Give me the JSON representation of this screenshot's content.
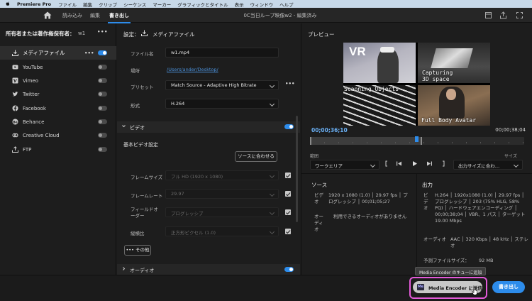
{
  "menubar": {
    "app_name": "Premiere Pro",
    "items": [
      "ファイル",
      "編集",
      "クリップ",
      "シーケンス",
      "マーカー",
      "グラフィックとタイトル",
      "表示",
      "ウィンドウ",
      "ヘルプ"
    ]
  },
  "titlebar": {
    "tabs": [
      "読み込み",
      "編集",
      "書き出し"
    ],
    "active_tab": "書き出し",
    "document_title": "0C当日ループ映像w2 - 編集済み"
  },
  "left_panel": {
    "owner_label": "所有者または著作権保有者：",
    "owner_value": "w1",
    "destinations": [
      {
        "label": "メディアファイル",
        "enabled": true,
        "selected": true,
        "icon": "media-file-icon"
      },
      {
        "label": "YouTube",
        "enabled": false,
        "icon": "youtube-icon"
      },
      {
        "label": "Vimeo",
        "enabled": false,
        "icon": "vimeo-icon"
      },
      {
        "label": "Twitter",
        "enabled": false,
        "icon": "twitter-icon"
      },
      {
        "label": "Facebook",
        "enabled": false,
        "icon": "facebook-icon"
      },
      {
        "label": "Behance",
        "enabled": false,
        "icon": "behance-icon"
      },
      {
        "label": "Creative Cloud",
        "enabled": false,
        "icon": "creative-cloud-icon"
      },
      {
        "label": "FTP",
        "enabled": false,
        "icon": "ftp-icon"
      }
    ]
  },
  "settings": {
    "header_label": "設定：",
    "header_value": "メディアファイル",
    "filename_label": "ファイル名",
    "filename_value": "w1.mp4",
    "location_label": "場所",
    "location_value": "/Users/ander/Desktop/",
    "preset_label": "プリセット",
    "preset_value": "Match Source - Adaptive High Bitrate",
    "format_label": "形式",
    "format_value": "H.264",
    "video_section": "ビデオ",
    "basic_video": "基本ビデオ設定",
    "match_source_button": "ソースに合わせる",
    "frame_size_label": "フレームサイズ",
    "frame_size_value": "フル HD (1920 x 1080)",
    "frame_rate_label": "フレームレート",
    "frame_rate_value": "29.97",
    "field_order_label": "フィールドオーダー",
    "field_order_value": "プログレッシブ",
    "aspect_label": "縦横比",
    "aspect_value": "正方形ピクセル (1.0)",
    "more_button": "その他",
    "audio_section": "オーディオ"
  },
  "preview": {
    "title": "プレビュー",
    "quadrant_texts": {
      "q1": "VR",
      "q2": "Capturing\n3D space",
      "q3": "Scanning Objects",
      "q4": "Full Body Avatar"
    },
    "timecode_current": "00;00;36;10",
    "timecode_end": "00;00;38;04",
    "range_label": "範囲",
    "range_value": "ワークエリア",
    "size_label": "サイズ",
    "size_value": "出力サイズに合わ…"
  },
  "source_info": {
    "title": "ソース",
    "video_key": "ビデオ",
    "video_value": "1920 x 1080 (1.0) │ 29.97 fps │ プログレッシブ │ 00;01;05;27",
    "audio_key": "オーディオ",
    "audio_value": "利用できるオーディオがありません"
  },
  "output_info": {
    "title": "出力",
    "video_key": "ビデオ",
    "video_value": "H.264 │ 1920x1080 (1.0) │ 29.97 fps │ プログレッシブ │ 203 (75% HLG, 58% PQ) │ ハードウェアエンコーディング │ 00;00;38;04 │ VBR、1 パス │ ターゲット 19.00 Mbps",
    "audio_key": "オーディオ",
    "audio_value": "AAC │ 320 Kbps │ 48 kHz │ ステレオ",
    "filesize_label": "予測ファイルサイズ：",
    "filesize_value": "92 MB"
  },
  "footer": {
    "tooltip": "Media Encoder のキューに追加",
    "media_encoder_button": "Media Encoder に送信",
    "media_encoder_icon_text": "Me",
    "export_button": "書き出し"
  },
  "colors": {
    "accent": "#2d8ceb",
    "highlight": "#e35ad9"
  }
}
